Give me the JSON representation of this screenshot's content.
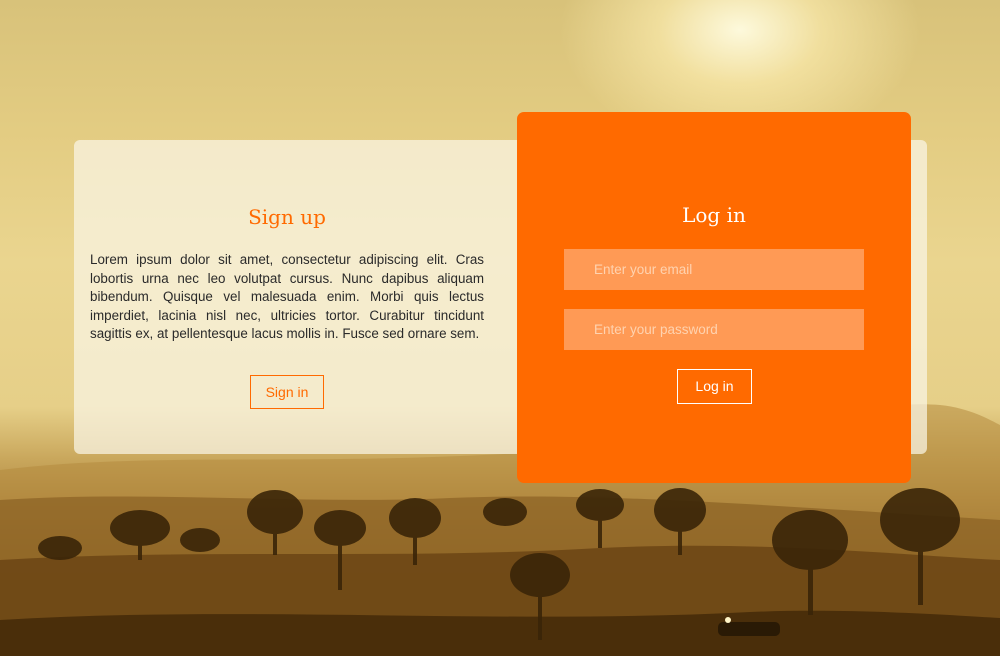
{
  "signup": {
    "title": "Sign up",
    "description": "Lorem ipsum dolor sit amet, consectetur adipiscing elit. Cras lobortis urna nec leo volutpat cursus. Nunc dapibus aliquam bibendum. Quisque vel malesuada enim. Morbi quis lectus imperdiet, lacinia nisl nec, ultricies tortor. Curabitur tincidunt sagittis ex, at pellentesque lacus mollis in. Fusce sed ornare sem.",
    "button_label": "Sign in"
  },
  "login": {
    "title": "Log in",
    "email_placeholder": "Enter your email",
    "password_placeholder": "Enter your password",
    "button_label": "Log in"
  },
  "colors": {
    "accent": "#ff6a00",
    "input_bg": "#ff9a55",
    "panel_bg": "#faf5e6"
  }
}
